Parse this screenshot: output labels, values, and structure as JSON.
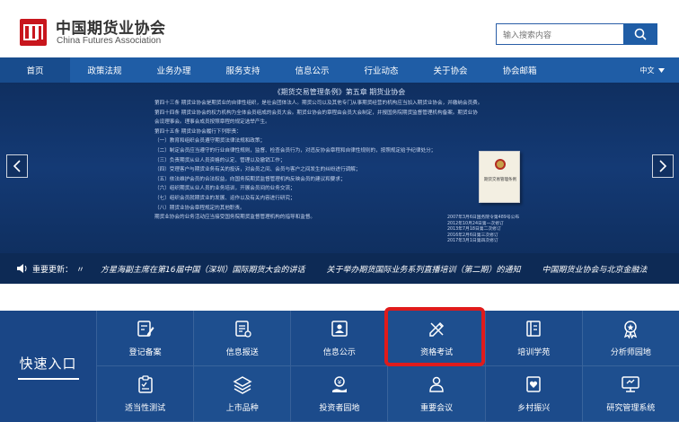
{
  "header": {
    "logo_cn": "中国期货业协会",
    "logo_en": "China Futures Association",
    "search_placeholder": "输入搜索内容"
  },
  "nav": {
    "items": [
      "首页",
      "政策法规",
      "业务办理",
      "服务支持",
      "信息公示",
      "行业动态",
      "关于协会",
      "协会邮箱"
    ],
    "active": "首页",
    "language": "中文"
  },
  "banner": {
    "title": "《期货交易管理条例》第五章  期货业协会",
    "paragraphs": [
      "第四十三条  期货业协会是期货业的自律性组织，是社会团体法人。期货公司以及其他专门从事期货经营的机构应当加入期货业协会，并缴纳会员费。",
      "第四十四条  期货业协会的权力机构为全体会员组成的会员大会。期货业协会的章程由会员大会制定，并报国务院期货监督管理机构备案。期货业协",
      "会设理事会。理事会成员按照章程的规定选举产生。",
      "第四十五条  期货业协会履行下列职责：",
      "（一）教育和组织会员遵守期货法律法规和政策；",
      "（二）制定会员应当遵守的行业自律性规则，监督、检查会员行为，对违反协会章程和自律性规则的，按照规定给予纪律处分；",
      "（三）负责期货从业人员资格的认定、管理以及撤销工作；",
      "（四）受理客户与期货业务有关的投诉，对会员之间、会员与客户之间发生的纠纷进行调解；",
      "（五）依法维护会员的合法权益，向国务院期货监督管理机构反映会员的建议和要求；",
      "（六）组织期货从业人员的业务培训，开展会员间的业务交流；",
      "（七）组织会员就期货业的发展、运作以及有关内容进行研究；",
      "（八）期货业协会章程规定的其他职责。",
      "期货业协会的业务活动应当接受国务院期货监督管理机构的指导和监督。"
    ],
    "book_title": "期货交易管理条例",
    "book_note": [
      "2007年3月6日国务院令第489号公布",
      "2012年10月24日第一次修订",
      "2013年7月18日第二次修订",
      "2016年2月6日第三次修订",
      "2017年3月1日第四次修订"
    ]
  },
  "ticker": {
    "label": "重要更新：",
    "items": [
      "方星海副主席在第16届中国（深圳）国际期货大会的讲话",
      "关于举办期货国际业务系列直播培训（第二期）的通知",
      "中国期货业协会与北京金融法"
    ]
  },
  "quick": {
    "title": "快速入口",
    "items": [
      {
        "label": "登记备案",
        "icon": "edit-icon"
      },
      {
        "label": "信息报送",
        "icon": "report-icon"
      },
      {
        "label": "信息公示",
        "icon": "id-card-icon"
      },
      {
        "label": "资格考试",
        "icon": "pen-ruler-icon"
      },
      {
        "label": "培训学苑",
        "icon": "book-icon"
      },
      {
        "label": "分析师园地",
        "icon": "award-icon"
      },
      {
        "label": "适当性测试",
        "icon": "checklist-icon"
      },
      {
        "label": "上市品种",
        "icon": "layers-icon"
      },
      {
        "label": "投资者园地",
        "icon": "investor-icon"
      },
      {
        "label": "重要会议",
        "icon": "meeting-icon"
      },
      {
        "label": "乡村振兴",
        "icon": "heart-book-icon"
      },
      {
        "label": "研究管理系统",
        "icon": "monitor-icon"
      }
    ]
  },
  "colors": {
    "brand_red": "#c8161d",
    "nav_blue": "#1f5da6",
    "quick_blue": "#1b4a88",
    "highlight_red": "#e01b1b"
  }
}
